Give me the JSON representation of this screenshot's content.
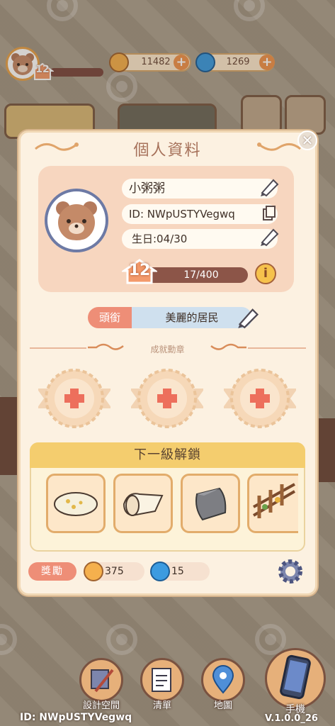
{
  "hud": {
    "player_level": "12",
    "coins": "11482",
    "gems": "1269"
  },
  "dialog": {
    "title": "個人資料",
    "nickname": "小粥粥",
    "player_id": "ID: NWpUSTYVegwq",
    "birthday": "生日:04/30",
    "level": "12",
    "xp_text": "17/400",
    "title_label": "頭銜",
    "title_value": "美麗的居民",
    "medal_header": "成就勳章",
    "unlock_header": "下一級解鎖",
    "reward_label": "獎勵",
    "reward_coins": "375",
    "reward_gems": "15"
  },
  "nav": {
    "design": "設計空間",
    "list": "清單",
    "map": "地圖",
    "phone": "手機"
  },
  "footer": {
    "id": "ID:  NWpUSTYVegwq",
    "version": "V.1.0.0_26"
  },
  "colors": {
    "dialog_bg": "#fcf1e1",
    "accent_pink": "#ee8e77",
    "xp_bar": "#8c5548",
    "unlock_header": "#f4cd6e"
  }
}
